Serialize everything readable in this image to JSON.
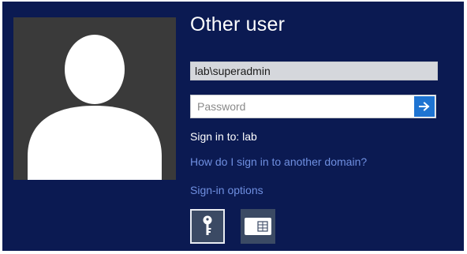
{
  "login": {
    "title": "Other user",
    "username": "lab\\superadmin",
    "password_placeholder": "Password",
    "password_value": "",
    "sign_in_to": "Sign in to: lab",
    "domain_help_link": "How do I sign in to another domain?",
    "sign_in_options_link": "Sign-in options"
  },
  "sign_in_options": [
    {
      "name": "password-key-icon",
      "selected": true
    },
    {
      "name": "smart-card-icon",
      "selected": false
    }
  ],
  "colors": {
    "background": "#0b1a52",
    "avatar_background": "#3a3a3a",
    "link": "#6f8fe0",
    "submit_button": "#1e74d2",
    "username_field": "#d5d7dc",
    "option_tile": "#3b4a64"
  },
  "icons": {
    "avatar": "user-silhouette-icon",
    "submit": "arrow-right-icon"
  }
}
